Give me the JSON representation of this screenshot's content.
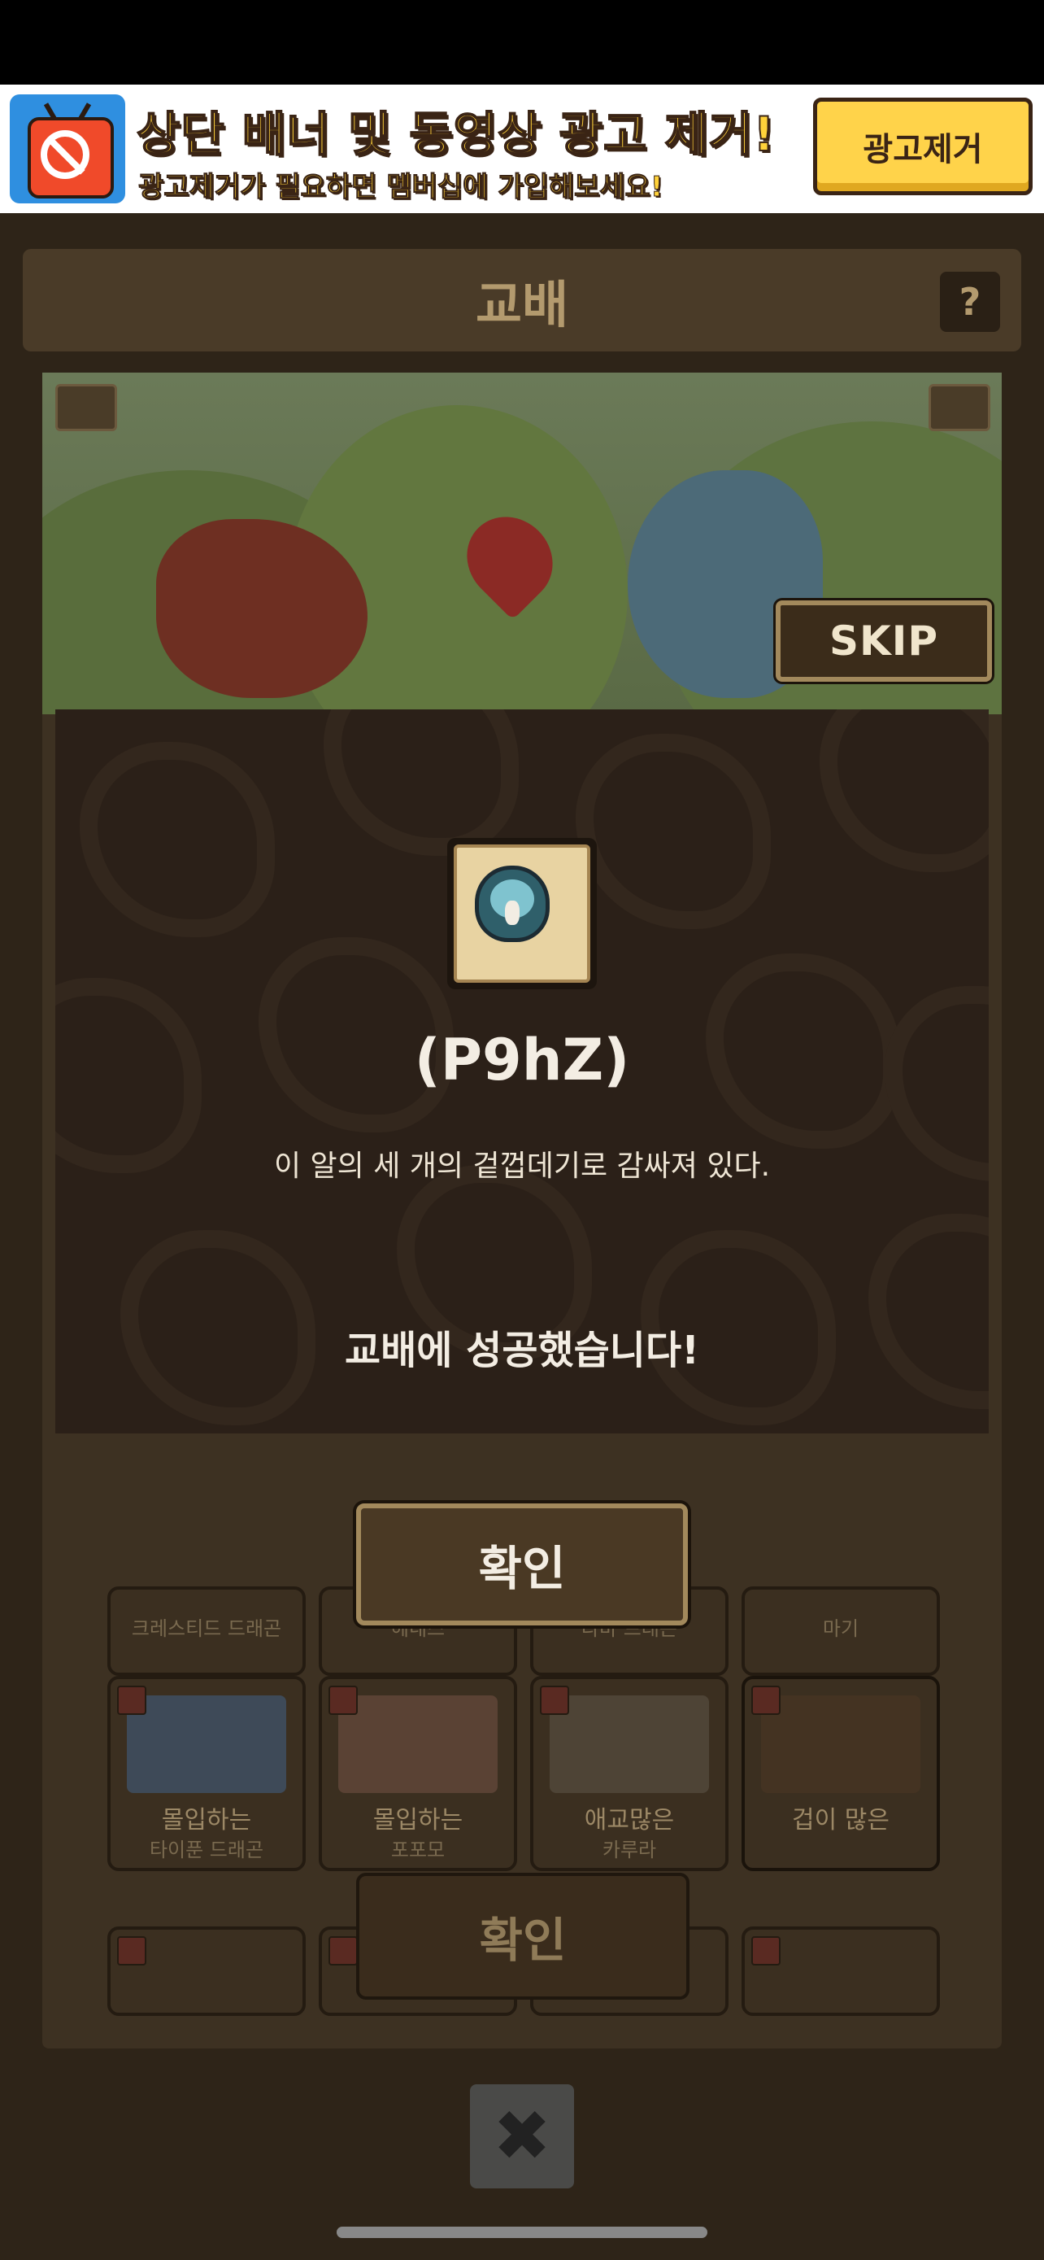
{
  "ad": {
    "title": "상단 배너 및 동영상 광고 제거!",
    "subtitle": "광고제거가 필요하면 멤버십에 가입해보세요!",
    "button_label": "광고제거"
  },
  "header": {
    "title": "교배",
    "help_label": "?"
  },
  "skip_label": "SKIP",
  "cards": [
    {
      "line1": "",
      "line2": "크레스티드 드래곤"
    },
    {
      "line1": "",
      "line2": "헤네스"
    },
    {
      "line1": "",
      "line2": "라바 드래곤"
    },
    {
      "line1": "",
      "line2": "마기"
    },
    {
      "line1": "몰입하는",
      "line2": "타이푼 드래곤"
    },
    {
      "line1": "몰입하는",
      "line2": "포포모"
    },
    {
      "line1": "애교많은",
      "line2": "카루라"
    },
    {
      "line1": "겁이 많은",
      "line2": ""
    }
  ],
  "bottom_confirm_label": "확인",
  "close_label": "✖",
  "popup": {
    "item_name": "(P9hZ)",
    "item_description": "이 알의 세 개의 겉껍데기로 감싸져 있다.",
    "result_message": "교배에 성공했습니다!",
    "confirm_label": "확인"
  },
  "colors": {
    "popup_bg": "#2b2018",
    "button_border": "#a2895c",
    "ad_accent": "#ffd23a"
  }
}
